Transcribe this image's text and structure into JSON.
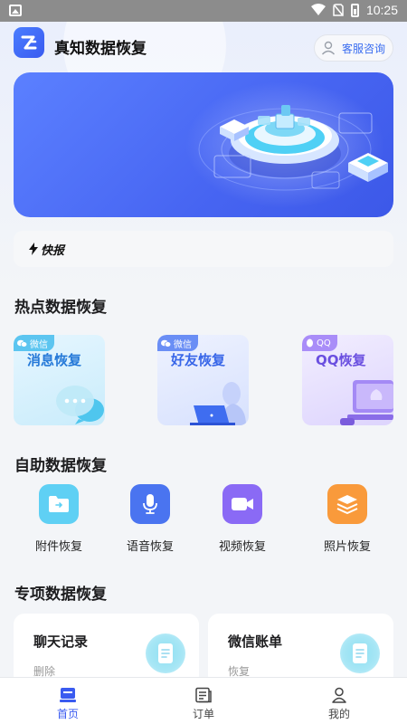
{
  "status_bar": {
    "time": "10:25"
  },
  "header": {
    "app_title": "真知数据恢复",
    "service_label": "客服咨询"
  },
  "news": {
    "label": "快报"
  },
  "sections": {
    "hot": "热点数据恢复",
    "self_service": "自助数据恢复",
    "special": "专项数据恢复"
  },
  "hot_cards": [
    {
      "tag": "微信",
      "title": "消息恢复",
      "tag_color": "#5cc5f0",
      "title_color": "#2579d8"
    },
    {
      "tag": "微信",
      "title": "好友恢复",
      "tag_color": "#6a8ef5",
      "title_color": "#3866e8"
    },
    {
      "tag": "QQ",
      "title": "QQ恢复",
      "tag_color": "#a98df8",
      "title_color": "#6a4fe0"
    }
  ],
  "tools": [
    {
      "label": "附件恢复",
      "icon": "folder-icon",
      "color": "#5fd0f4"
    },
    {
      "label": "语音恢复",
      "icon": "microphone-icon",
      "color": "#4a74f0"
    },
    {
      "label": "视频恢复",
      "icon": "video-icon",
      "color": "#8a6af5"
    },
    {
      "label": "照片恢复",
      "icon": "layers-icon",
      "color": "#f99a3b"
    }
  ],
  "special_cards": [
    {
      "title": "聊天记录",
      "sub": "删除"
    },
    {
      "title": "微信账单",
      "sub": "恢复"
    }
  ],
  "nav": [
    {
      "label": "首页",
      "icon": "home-icon",
      "active": true
    },
    {
      "label": "订单",
      "icon": "order-icon",
      "active": false
    },
    {
      "label": "我的",
      "icon": "profile-icon",
      "active": false
    }
  ],
  "colors": {
    "accent": "#3a5bf0",
    "banner": "#4765f2",
    "background": "#f3f5f8"
  }
}
